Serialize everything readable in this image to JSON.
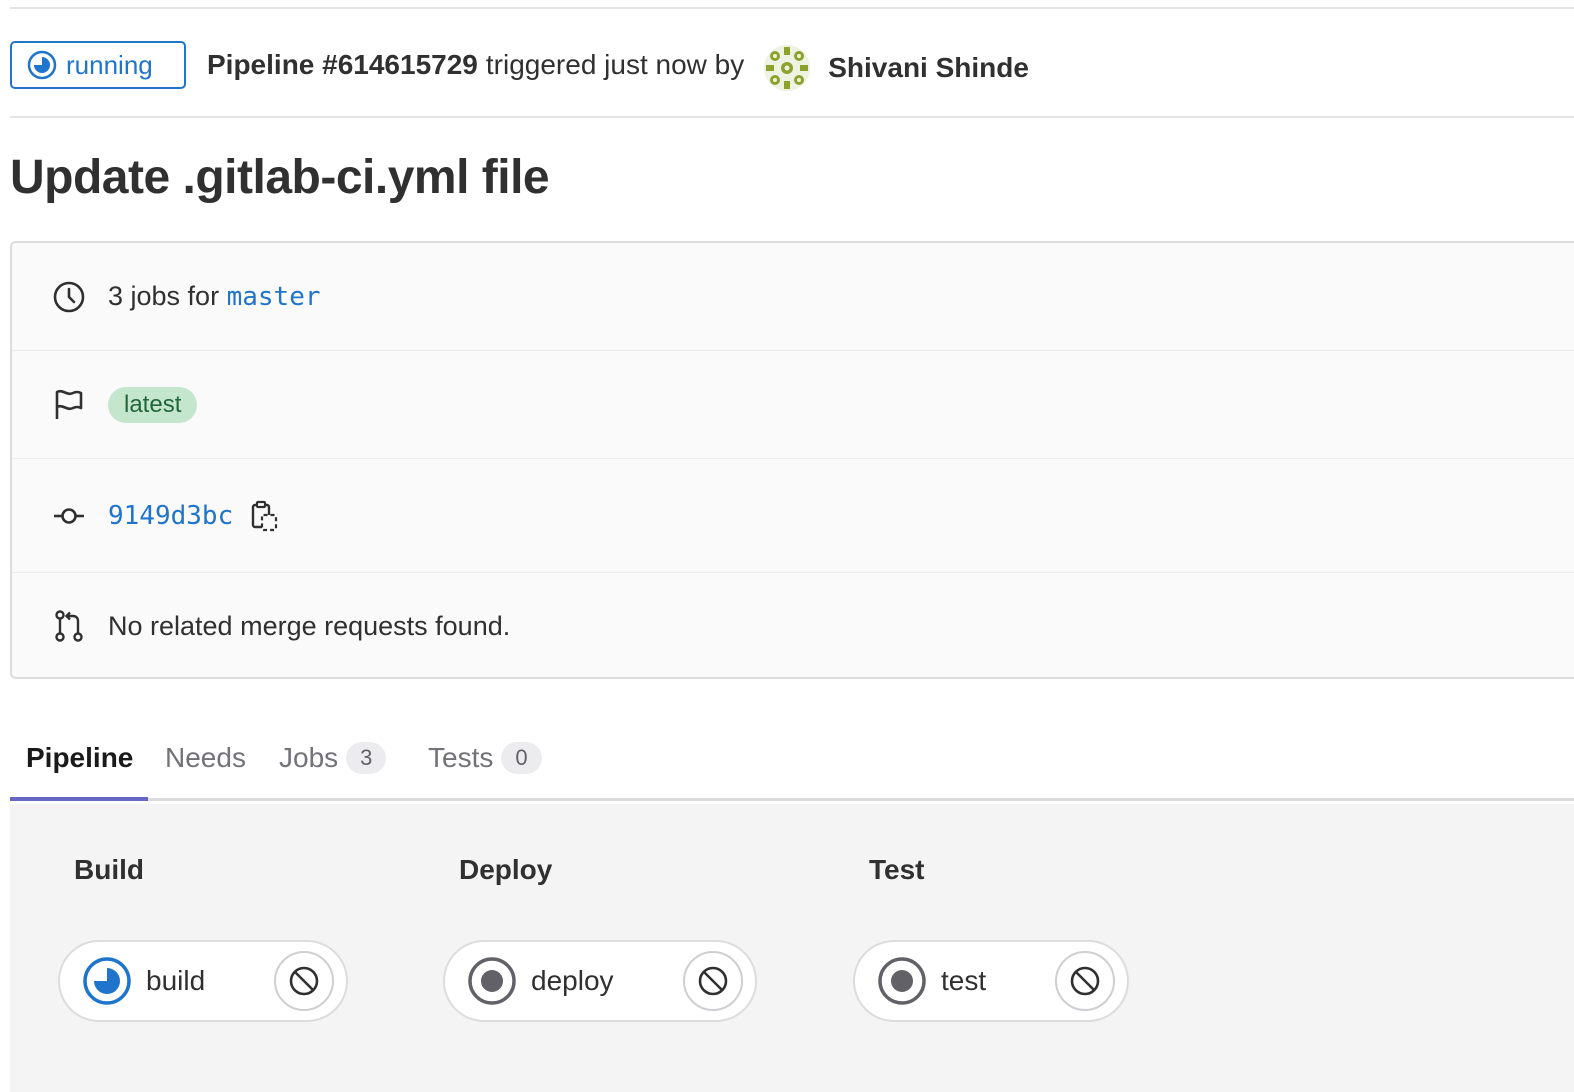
{
  "header": {
    "status_label": "running",
    "pipeline_id": "Pipeline #614615729",
    "trigger_text": "triggered just now by",
    "user_name": "Shivani Shinde"
  },
  "title": "Update .gitlab-ci.yml file",
  "info": {
    "jobs_prefix": "3 jobs for",
    "branch": "master",
    "badge": "latest",
    "commit_sha": "9149d3bc",
    "merge_requests": "No related merge requests found."
  },
  "tabs": [
    {
      "label": "Pipeline"
    },
    {
      "label": "Needs"
    },
    {
      "label": "Jobs",
      "count": "3"
    },
    {
      "label": "Tests",
      "count": "0"
    }
  ],
  "stages": [
    {
      "title": "Build",
      "job": "build",
      "status": "running"
    },
    {
      "title": "Deploy",
      "job": "deploy",
      "status": "created"
    },
    {
      "title": "Test",
      "job": "test",
      "status": "created"
    }
  ],
  "colors": {
    "accent_blue": "#1f75cb",
    "badge_green_bg": "#c3e6cd",
    "tab_underline": "#6666c4"
  },
  "icons": {
    "status": "status-running-icon",
    "clock": "clock-icon",
    "flag": "flag-icon",
    "commit": "commit-icon",
    "copy": "copy-to-clipboard-icon",
    "merge_request": "merge-request-icon",
    "cancel": "cancel-icon"
  }
}
